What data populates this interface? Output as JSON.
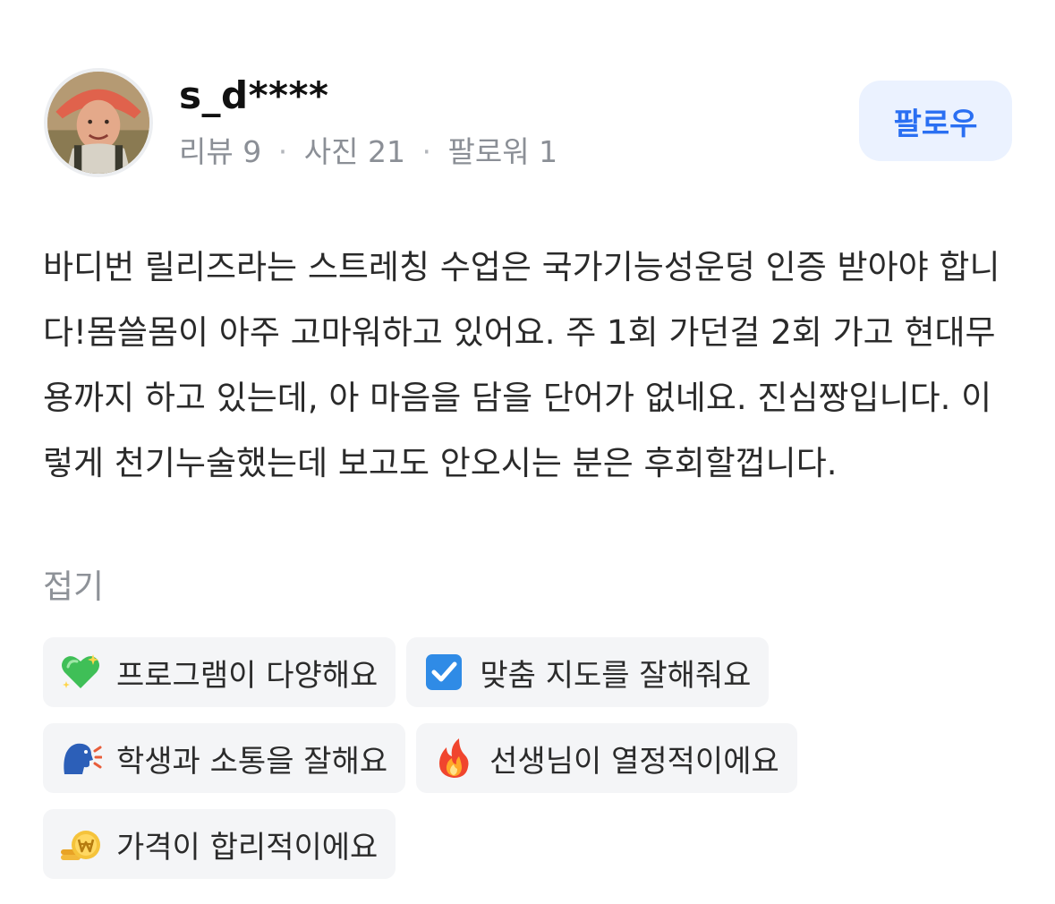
{
  "profile": {
    "username": "s_d****",
    "stats": [
      {
        "label": "리뷰",
        "value": "9"
      },
      {
        "label": "사진",
        "value": "21"
      },
      {
        "label": "팔로워",
        "value": "1"
      }
    ],
    "separator": "·",
    "follow_label": "팔로우"
  },
  "review": {
    "text": "바디번 릴리즈라는 스트레칭 수업은 국가기능성운덩 인증 받아야 합니다!몸쓸몸이 아주 고마워하고 있어요. 주 1회 가던걸 2회 가고 현대무용까지 하고 있는데, 아 마음을 담을 단어가 없네요. 진심짱입니다. 이렇게 천기누술했는데 보고도 안오시는 분은 후회할껍니다.",
    "collapse_label": "접기"
  },
  "keywords": [
    {
      "icon": "green-heart-icon",
      "label": "프로그램이 다양해요"
    },
    {
      "icon": "check-box-icon",
      "label": "맞춤 지도를 잘해줘요"
    },
    {
      "icon": "speaking-head-icon",
      "label": "학생과 소통을 잘해요"
    },
    {
      "icon": "fire-icon",
      "label": "선생님이 열정적이에요"
    },
    {
      "icon": "won-coin-icon",
      "label": "가격이 합리적이에요"
    }
  ],
  "colors": {
    "accent": "#2a6ff2",
    "follow_bg": "#ebf2ff",
    "chip_bg": "#f4f5f7",
    "muted_text": "#8b8f96"
  }
}
